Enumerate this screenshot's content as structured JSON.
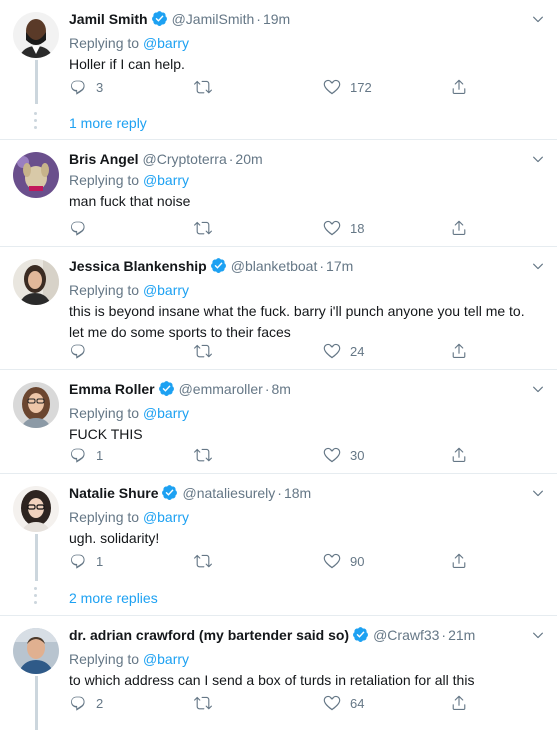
{
  "theme": {
    "link_color": "#1da1f2",
    "muted_color": "#657786",
    "verified_color": "#1da1f2",
    "line_color": "#ccd6dd"
  },
  "tweets": [
    {
      "name": "Jamil Smith",
      "verified": true,
      "handle": "@JamilSmith",
      "time": "19m",
      "reply_prefix": "Replying to",
      "reply_to": "@barry",
      "text": [
        "Holler if I can help."
      ],
      "replies": "3",
      "retweets": "",
      "likes": "172",
      "avatar": "avatar-jamil"
    },
    {
      "name": "Bris Angel",
      "verified": false,
      "handle": "@Cryptoterra",
      "time": "20m",
      "reply_prefix": "Replying to",
      "reply_to": "@barry",
      "text": [
        "man fuck that noise"
      ],
      "replies": "",
      "retweets": "",
      "likes": "18",
      "avatar": "avatar-bris"
    },
    {
      "name": "Jessica Blankenship",
      "verified": true,
      "handle": "@blanketboat",
      "time": "17m",
      "reply_prefix": "Replying to",
      "reply_to": "@barry",
      "text": [
        "this is beyond insane what the fuck. barry i'll punch anyone you tell me to.",
        "let me do some sports to their faces"
      ],
      "replies": "",
      "retweets": "",
      "likes": "24",
      "avatar": "avatar-jessica"
    },
    {
      "name": "Emma Roller",
      "verified": true,
      "handle": "@emmaroller",
      "time": "8m",
      "reply_prefix": "Replying to",
      "reply_to": "@barry",
      "text": [
        "FUCK THIS"
      ],
      "replies": "1",
      "retweets": "",
      "likes": "30",
      "avatar": "avatar-emma"
    },
    {
      "name": "Natalie Shure",
      "verified": true,
      "handle": "@nataliesurely",
      "time": "18m",
      "reply_prefix": "Replying to",
      "reply_to": "@barry",
      "text": [
        "ugh. solidarity!"
      ],
      "replies": "1",
      "retweets": "",
      "likes": "90",
      "avatar": "avatar-natalie"
    },
    {
      "name": "dr. adrian crawford (my bartender said so)",
      "verified": true,
      "handle": "@Crawf33",
      "time": "21m",
      "reply_prefix": "Replying to",
      "reply_to": "@barry",
      "text": [
        "to which address can I send a box of turds in retaliation for all this"
      ],
      "replies": "2",
      "retweets": "",
      "likes": "64",
      "avatar": "avatar-adrian"
    }
  ],
  "more_replies": [
    {
      "label": "1 more reply"
    },
    {
      "label": "2 more replies"
    }
  ],
  "icons": {
    "reply": "reply-icon",
    "retweet": "retweet-icon",
    "like": "heart-icon",
    "share": "share-icon",
    "caret": "chevron-down-icon",
    "verified": "verified-badge-icon"
  }
}
